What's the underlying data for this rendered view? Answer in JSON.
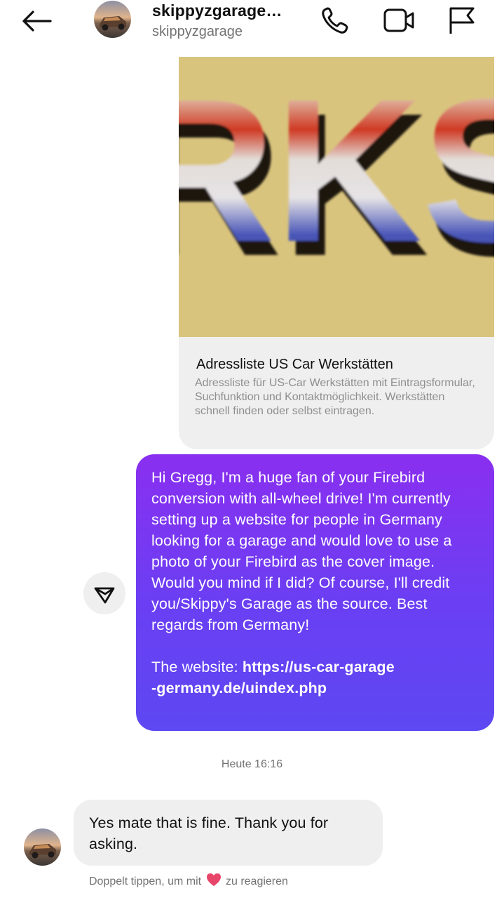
{
  "header": {
    "title": "skippyzgarage…",
    "username": "skippyzgarage",
    "icons": [
      "back-arrow-icon",
      "phone-icon",
      "video-icon",
      "flag-icon"
    ]
  },
  "shared_link": {
    "image_text": "RKS",
    "title": "Adressliste US Car Werkstätten",
    "description": "Adressliste für US-Car Werkstätten mit Eintragsformular, Suchfunktion und Kontaktmöglichkeit. Werkstätten schnell finden oder selbst eintragen."
  },
  "outgoing_message": {
    "body": "Hi Gregg, I'm a huge fan of your Firebird conversion with all-wheel drive! I'm currently setting up a website for people in Germany looking for a garage and would love to use a photo of your Firebird as the cover image. Would you mind if I did? Of course, I'll credit you/Skippy's Garage as the source. Best regards from Germany!",
    "website_label": "The website: ",
    "link_line1": "https://us-car-garage",
    "link_line2": "-germany.de/uindex.php"
  },
  "timestamp": "Heute 16:16",
  "incoming_message": {
    "body": "Yes mate that is fine. Thank you for asking."
  },
  "reaction_hint": {
    "before": "Doppelt tippen, um mit",
    "after": "zu reagieren"
  },
  "colors": {
    "bubble_gradient_top": "#8a2ff0",
    "bubble_gradient_bottom": "#5d48f2",
    "incoming_bubble": "#efefef",
    "heart": "#e8456b"
  }
}
